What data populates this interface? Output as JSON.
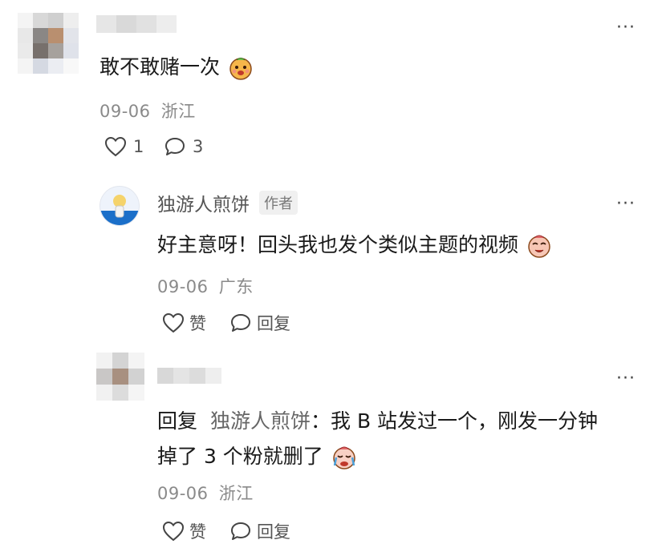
{
  "menu_icon": "more-horizontal-icon",
  "comments": [
    {
      "text": "敢不敢赌一次",
      "emoji": "face-emoji",
      "date": "09-06",
      "location": "浙江",
      "like_count": "1",
      "reply_count": "3"
    },
    {
      "author": "独游人煎饼",
      "badge": "作者",
      "text": "好主意呀！回头我也发个类似主题的视频",
      "emoji": "face-emoji",
      "date": "09-06",
      "location": "广东",
      "like_label": "赞",
      "reply_label": "回复"
    },
    {
      "reply_prefix": "回复",
      "reply_to": "独游人煎饼",
      "separator": "：",
      "text_line1": "我 B 站发过一个，刚发一分钟",
      "text_line2": "掉了 3 个粉就删了",
      "emoji": "crying-face-emoji",
      "date": "09-06",
      "location": "浙江",
      "like_label": "赞",
      "reply_label": "回复"
    }
  ],
  "colors": {
    "text": "#1a1a1a",
    "meta": "#8a8a8a",
    "background": "#ffffff"
  }
}
